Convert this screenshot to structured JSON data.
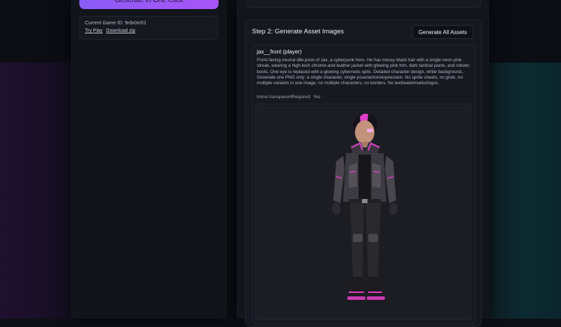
{
  "sidebar": {
    "generate_button_label": "Generate in One Click",
    "game_id_label": "Current Game ID:",
    "game_id_value": "9rdx0m51",
    "try_play_label": "Try Play",
    "download_label": "Download zip"
  },
  "step2": {
    "title": "Step 2: Generate Asset Images",
    "generate_all_label": "Generate All Assets",
    "asset": {
      "name": "jax__front (player)",
      "prompt": "Front-facing neutral idle pose of Jax, a cyberpunk hero. He has messy black hair with a single neon pink streak, wearing a high-tech chrome-and-leather jacket with glowing pink trim, dark tactical pants, and robotic boots. One eye is replaced with a glowing cybernetic optic. Detailed character design, white background.. Generate one PNG only: a single character, single pose/action/expression. No sprite sheets, no grids, no multiple variants in one image, no multiple characters, no borders. No text/watermarks/logos.",
      "transparent_label": "home.transparentRequired:",
      "transparent_value": "Yes"
    }
  },
  "colors": {
    "accent": "#a855f7",
    "neon_pink": "#e040c8",
    "panel": "#161820",
    "background": "#0d0f15"
  }
}
